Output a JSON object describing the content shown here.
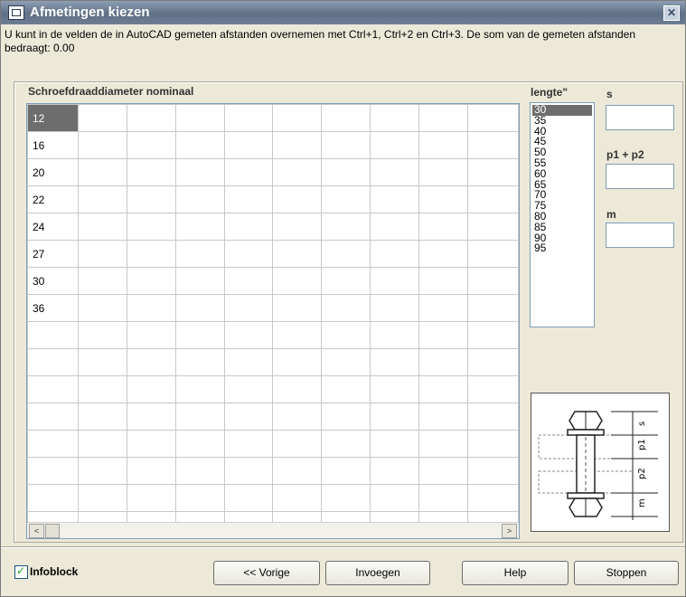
{
  "window": {
    "title": "Afmetingen kiezen",
    "close_glyph": "✕",
    "icon": "dialog-icon"
  },
  "info_text": "U kunt in de velden de in AutoCAD gemeten afstanden overnemen met Ctrl+1, Ctrl+2 en Ctrl+3. De som van de gemeten afstanden bedraagt: 0.00",
  "grid": {
    "label": "Schroefdraaddiameter nominaal",
    "rows": [
      "12",
      "16",
      "20",
      "22",
      "24",
      "27",
      "30",
      "36"
    ],
    "selected_row": "12",
    "scroll_left": "<",
    "scroll_right": ">"
  },
  "lengte": {
    "label": "lengte\"",
    "options": [
      "30",
      "35",
      "40",
      "45",
      "50",
      "55",
      "60",
      "65",
      "70",
      "75",
      "80",
      "85",
      "90",
      "95"
    ],
    "selected": "30"
  },
  "fields": {
    "s_label": "s",
    "s_value": "",
    "p_label": "p1 + p2",
    "p_value": "",
    "m_label": "m",
    "m_value": ""
  },
  "diagram": {
    "labels": [
      "s",
      "p1",
      "p2",
      "m"
    ]
  },
  "footer": {
    "infoblock_label": "Infoblock",
    "infoblock_checked": true,
    "prev_label": "<< Vorige",
    "insert_label": "Invoegen",
    "help_label": "Help",
    "stop_label": "Stoppen"
  }
}
